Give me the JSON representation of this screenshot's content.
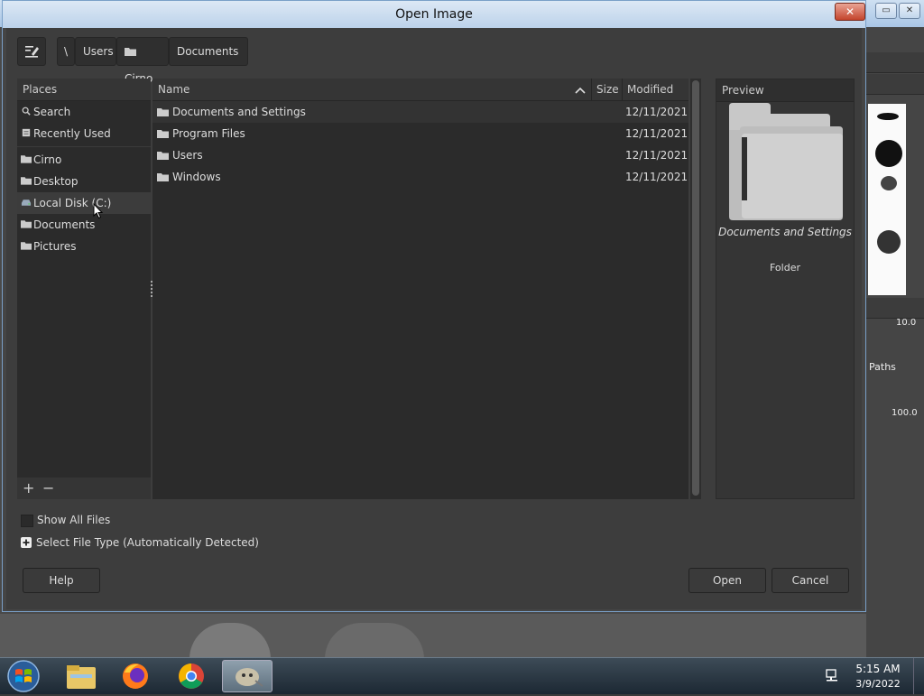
{
  "dialog": {
    "title": "Open Image",
    "close_label": "✕"
  },
  "pathbar": {
    "root": "\\",
    "crumbs": [
      "Users",
      "Cirno",
      "Documents"
    ]
  },
  "places": {
    "header": "Places",
    "items": [
      {
        "label": "Search",
        "icon": "search-icon"
      },
      {
        "label": "Recently Used",
        "icon": "recent-icon"
      },
      {
        "label": "Cirno",
        "icon": "folder-icon"
      },
      {
        "label": "Desktop",
        "icon": "folder-icon"
      },
      {
        "label": "Local Disk (C:)",
        "icon": "drive-icon",
        "selected": true
      },
      {
        "label": "Documents",
        "icon": "folder-icon"
      },
      {
        "label": "Pictures",
        "icon": "folder-icon"
      }
    ],
    "add_label": "+",
    "remove_label": "−"
  },
  "filelist": {
    "columns": {
      "name": "Name",
      "size": "Size",
      "modified": "Modified"
    },
    "rows": [
      {
        "name": "Documents and Settings",
        "size": "",
        "modified": "12/11/2021",
        "selected": true
      },
      {
        "name": "Program Files",
        "size": "",
        "modified": "12/11/2021"
      },
      {
        "name": "Users",
        "size": "",
        "modified": "12/11/2021"
      },
      {
        "name": "Windows",
        "size": "",
        "modified": "12/11/2021"
      }
    ]
  },
  "preview": {
    "header": "Preview",
    "name": "Documents and Settings",
    "type": "Folder"
  },
  "options": {
    "show_all_files": "Show All Files",
    "select_file_type": "Select File Type (Automatically Detected)"
  },
  "buttons": {
    "help": "Help",
    "open": "Open",
    "cancel": "Cancel"
  },
  "background": {
    "paths_tab": "Paths",
    "value_a": "10.0",
    "value_b": "100.0"
  },
  "taskbar": {
    "time": "5:15 AM",
    "date": "3/9/2022"
  },
  "colors": {
    "dialog_bg": "#3d3d3d",
    "pane_bg": "#2b2b2b",
    "title_bar": "#bcd2ea",
    "close_red": "#c4442c"
  }
}
